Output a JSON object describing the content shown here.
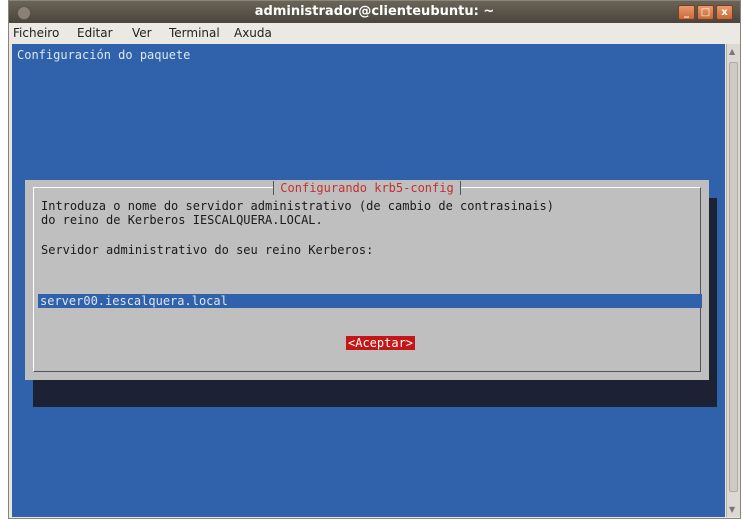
{
  "window": {
    "title": "administrador@clienteubuntu: ~",
    "controls": [
      "_",
      "□",
      "x"
    ]
  },
  "menubar": {
    "items": [
      "Ficheiro",
      "Editar",
      "Ver",
      "Terminal",
      "Axuda"
    ]
  },
  "terminal": {
    "package_config_title": "Configuración do paquete"
  },
  "dialog": {
    "title": "Configurando krb5-config",
    "line1": "Introduza o nome do servidor administrativo (de cambio de contrasinais)",
    "line2": "do reino de Kerberos IESCALQUERA.LOCAL.",
    "prompt": "Servidor administrativo do seu reino Kerberos:",
    "input_value": "server00.iescalquera.local",
    "ok_label": "<Aceptar>"
  },
  "colors": {
    "terminal_bg": "#2f62aa",
    "dialog_bg": "#bfbfbf",
    "accent": "#c41616"
  }
}
